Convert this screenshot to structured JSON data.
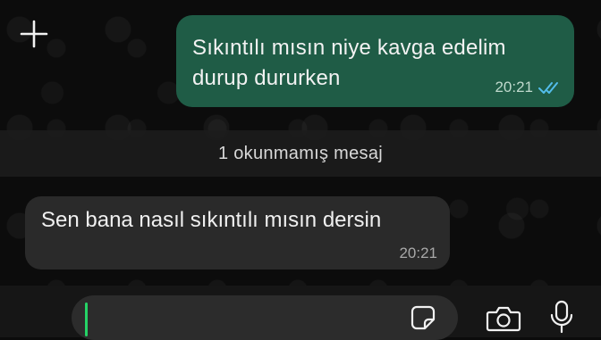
{
  "messages": {
    "outgoing": {
      "text": "Sıkıntılı mısın niye kavga edelim durup dururken",
      "time": "20:21",
      "status_icon": "double-check-read-icon"
    },
    "unread_divider": "1 okunmamış mesaj",
    "incoming": {
      "text": "Sen bana nasıl sıkıntılı mısın dersin",
      "time": "20:21"
    }
  },
  "input_bar": {
    "text_value": "",
    "icons": [
      "plus-icon",
      "sticker-icon",
      "camera-icon",
      "mic-icon"
    ]
  },
  "colors": {
    "outgoing_bubble": "#1f5c46",
    "incoming_bubble": "#2a2a2a",
    "read_ticks": "#53bdeb",
    "caret": "#25d366"
  }
}
